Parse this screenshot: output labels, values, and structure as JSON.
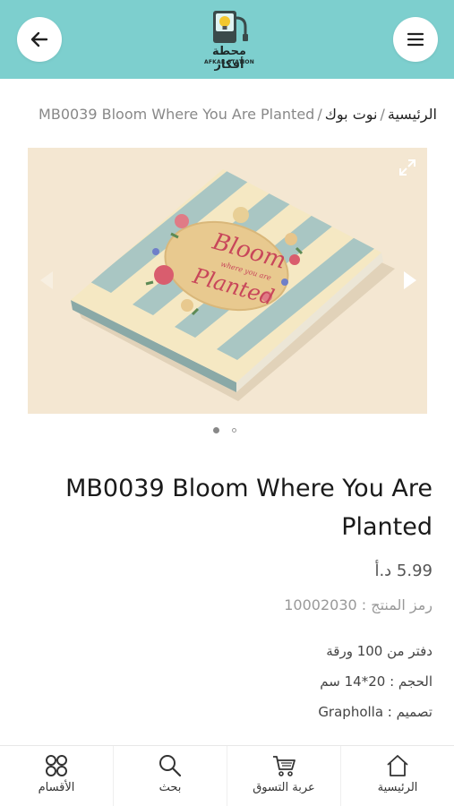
{
  "header": {
    "back_icon": "arrow-left-icon",
    "menu_icon": "hamburger-menu-icon",
    "logo": {
      "name_ar": "محطة أفكار",
      "name_en": "AFKAR STATION"
    },
    "background": "#7dcfce"
  },
  "breadcrumb": {
    "home": "الرئيسية",
    "category": "نوت بوك",
    "current": "MB0039 Bloom Where You Are Planted"
  },
  "gallery": {
    "image_text": [
      "Bloom",
      "where you are",
      "Planted"
    ],
    "slide_count": 2,
    "active_slide": 1
  },
  "product": {
    "title": "MB0039 Bloom Where You Are Planted",
    "price": "5.99 د.أ",
    "sku": "رمز المنتج : 10002030",
    "specs": [
      "دفتر من 100 ورقة",
      "الحجم : 20*14 سم",
      "تصميم : Grapholla"
    ]
  },
  "bottom_nav": [
    {
      "label": "الأقسام",
      "icon": "grid-dots-icon"
    },
    {
      "label": "بحث",
      "icon": "search-icon"
    },
    {
      "label": "عربة التسوق",
      "icon": "cart-icon"
    },
    {
      "label": "الرئيسية",
      "icon": "home-icon"
    }
  ]
}
